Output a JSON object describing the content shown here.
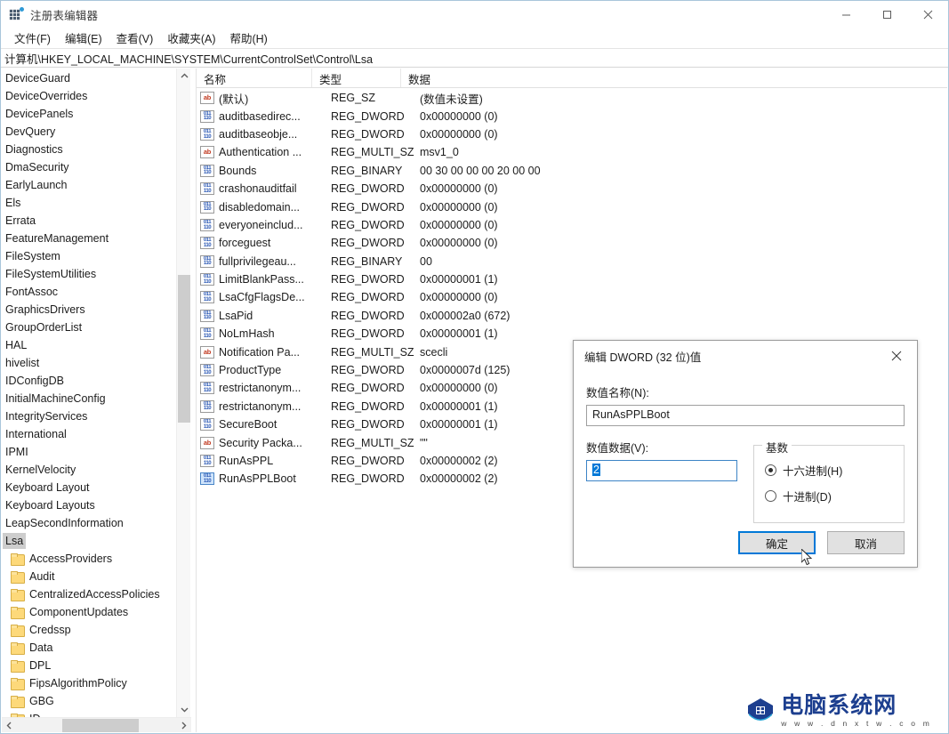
{
  "window": {
    "title": "注册表编辑器",
    "icon": "registry-icon",
    "controls": {
      "minimize": "minimize-icon",
      "maximize": "maximize-icon",
      "close": "close-icon"
    }
  },
  "menubar": {
    "items": [
      {
        "label": "文件(F)"
      },
      {
        "label": "编辑(E)"
      },
      {
        "label": "查看(V)"
      },
      {
        "label": "收藏夹(A)"
      },
      {
        "label": "帮助(H)"
      }
    ]
  },
  "addressbar": {
    "path": "计算机\\HKEY_LOCAL_MACHINE\\SYSTEM\\CurrentControlSet\\Control\\Lsa"
  },
  "tree": {
    "nodes": [
      {
        "label": "DeviceGuard",
        "folder": false,
        "selected": false
      },
      {
        "label": "DeviceOverrides",
        "folder": false,
        "selected": false
      },
      {
        "label": "DevicePanels",
        "folder": false,
        "selected": false
      },
      {
        "label": "DevQuery",
        "folder": false,
        "selected": false
      },
      {
        "label": "Diagnostics",
        "folder": false,
        "selected": false
      },
      {
        "label": "DmaSecurity",
        "folder": false,
        "selected": false
      },
      {
        "label": "EarlyLaunch",
        "folder": false,
        "selected": false
      },
      {
        "label": "Els",
        "folder": false,
        "selected": false
      },
      {
        "label": "Errata",
        "folder": false,
        "selected": false
      },
      {
        "label": "FeatureManagement",
        "folder": false,
        "selected": false
      },
      {
        "label": "FileSystem",
        "folder": false,
        "selected": false
      },
      {
        "label": "FileSystemUtilities",
        "folder": false,
        "selected": false
      },
      {
        "label": "FontAssoc",
        "folder": false,
        "selected": false
      },
      {
        "label": "GraphicsDrivers",
        "folder": false,
        "selected": false
      },
      {
        "label": "GroupOrderList",
        "folder": false,
        "selected": false
      },
      {
        "label": "HAL",
        "folder": false,
        "selected": false
      },
      {
        "label": "hivelist",
        "folder": false,
        "selected": false
      },
      {
        "label": "IDConfigDB",
        "folder": false,
        "selected": false
      },
      {
        "label": "InitialMachineConfig",
        "folder": false,
        "selected": false
      },
      {
        "label": "IntegrityServices",
        "folder": false,
        "selected": false
      },
      {
        "label": "International",
        "folder": false,
        "selected": false
      },
      {
        "label": "IPMI",
        "folder": false,
        "selected": false
      },
      {
        "label": "KernelVelocity",
        "folder": false,
        "selected": false
      },
      {
        "label": "Keyboard Layout",
        "folder": false,
        "selected": false
      },
      {
        "label": "Keyboard Layouts",
        "folder": false,
        "selected": false
      },
      {
        "label": "LeapSecondInformation",
        "folder": false,
        "selected": false
      },
      {
        "label": "Lsa",
        "folder": false,
        "selected": true
      },
      {
        "label": "AccessProviders",
        "folder": true,
        "selected": false
      },
      {
        "label": "Audit",
        "folder": true,
        "selected": false
      },
      {
        "label": "CentralizedAccessPolicies",
        "folder": true,
        "selected": false
      },
      {
        "label": "ComponentUpdates",
        "folder": true,
        "selected": false
      },
      {
        "label": "Credssp",
        "folder": true,
        "selected": false
      },
      {
        "label": "Data",
        "folder": true,
        "selected": false
      },
      {
        "label": "DPL",
        "folder": true,
        "selected": false
      },
      {
        "label": "FipsAlgorithmPolicy",
        "folder": true,
        "selected": false
      },
      {
        "label": "GBG",
        "folder": true,
        "selected": false
      },
      {
        "label": "ID",
        "folder": true,
        "selected": false
      }
    ]
  },
  "list": {
    "columns": [
      "名称",
      "类型",
      "数据"
    ],
    "rows": [
      {
        "icon": "string-value-icon",
        "kind": "ab",
        "name": "(默认)",
        "type": "REG_SZ",
        "data": "(数值未设置)",
        "selected": false
      },
      {
        "icon": "dword-value-icon",
        "kind": "bin",
        "name": "auditbasedirec...",
        "type": "REG_DWORD",
        "data": "0x00000000 (0)",
        "selected": false
      },
      {
        "icon": "dword-value-icon",
        "kind": "bin",
        "name": "auditbaseobje...",
        "type": "REG_DWORD",
        "data": "0x00000000 (0)",
        "selected": false
      },
      {
        "icon": "string-value-icon",
        "kind": "ab",
        "name": "Authentication ...",
        "type": "REG_MULTI_SZ",
        "data": "msv1_0",
        "selected": false
      },
      {
        "icon": "dword-value-icon",
        "kind": "bin",
        "name": "Bounds",
        "type": "REG_BINARY",
        "data": "00 30 00 00 00 20 00 00",
        "selected": false
      },
      {
        "icon": "dword-value-icon",
        "kind": "bin",
        "name": "crashonauditfail",
        "type": "REG_DWORD",
        "data": "0x00000000 (0)",
        "selected": false
      },
      {
        "icon": "dword-value-icon",
        "kind": "bin",
        "name": "disabledomain...",
        "type": "REG_DWORD",
        "data": "0x00000000 (0)",
        "selected": false
      },
      {
        "icon": "dword-value-icon",
        "kind": "bin",
        "name": "everyoneinclud...",
        "type": "REG_DWORD",
        "data": "0x00000000 (0)",
        "selected": false
      },
      {
        "icon": "dword-value-icon",
        "kind": "bin",
        "name": "forceguest",
        "type": "REG_DWORD",
        "data": "0x00000000 (0)",
        "selected": false
      },
      {
        "icon": "dword-value-icon",
        "kind": "bin",
        "name": "fullprivilegeau...",
        "type": "REG_BINARY",
        "data": "00",
        "selected": false
      },
      {
        "icon": "dword-value-icon",
        "kind": "bin",
        "name": "LimitBlankPass...",
        "type": "REG_DWORD",
        "data": "0x00000001 (1)",
        "selected": false
      },
      {
        "icon": "dword-value-icon",
        "kind": "bin",
        "name": "LsaCfgFlagsDe...",
        "type": "REG_DWORD",
        "data": "0x00000000 (0)",
        "selected": false
      },
      {
        "icon": "dword-value-icon",
        "kind": "bin",
        "name": "LsaPid",
        "type": "REG_DWORD",
        "data": "0x000002a0 (672)",
        "selected": false
      },
      {
        "icon": "dword-value-icon",
        "kind": "bin",
        "name": "NoLmHash",
        "type": "REG_DWORD",
        "data": "0x00000001 (1)",
        "selected": false
      },
      {
        "icon": "string-value-icon",
        "kind": "ab",
        "name": "Notification Pa...",
        "type": "REG_MULTI_SZ",
        "data": "scecli",
        "selected": false
      },
      {
        "icon": "dword-value-icon",
        "kind": "bin",
        "name": "ProductType",
        "type": "REG_DWORD",
        "data": "0x0000007d (125)",
        "selected": false
      },
      {
        "icon": "dword-value-icon",
        "kind": "bin",
        "name": "restrictanonym...",
        "type": "REG_DWORD",
        "data": "0x00000000 (0)",
        "selected": false
      },
      {
        "icon": "dword-value-icon",
        "kind": "bin",
        "name": "restrictanonym...",
        "type": "REG_DWORD",
        "data": "0x00000001 (1)",
        "selected": false
      },
      {
        "icon": "dword-value-icon",
        "kind": "bin",
        "name": "SecureBoot",
        "type": "REG_DWORD",
        "data": "0x00000001 (1)",
        "selected": false
      },
      {
        "icon": "string-value-icon",
        "kind": "ab",
        "name": "Security Packa...",
        "type": "REG_MULTI_SZ",
        "data": "\"\"",
        "selected": false
      },
      {
        "icon": "dword-value-icon",
        "kind": "bin",
        "name": "RunAsPPL",
        "type": "REG_DWORD",
        "data": "0x00000002 (2)",
        "selected": false
      },
      {
        "icon": "dword-value-icon",
        "kind": "bin",
        "name": "RunAsPPLBoot",
        "type": "REG_DWORD",
        "data": "0x00000002 (2)",
        "selected": true
      }
    ]
  },
  "dialog": {
    "title": "编辑 DWORD (32 位)值",
    "name_label": "数值名称(N):",
    "name_value": "RunAsPPLBoot",
    "data_label": "数值数据(V):",
    "data_value": "2",
    "base_legend": "基数",
    "base_options": [
      {
        "label": "十六进制(H)",
        "checked": true
      },
      {
        "label": "十进制(D)",
        "checked": false
      }
    ],
    "ok_label": "确定",
    "cancel_label": "取消",
    "close_icon": "close-icon"
  },
  "watermark": {
    "title": "电脑系统网",
    "url": "w w w . d n x t w . c o m"
  },
  "colors": {
    "accent": "#0078d7",
    "selection": "#cdcdcd",
    "folder": "#fdd97a",
    "string_icon": "#c23b22",
    "dword_icon": "#2a58b5",
    "watermark": "#1d3f8f"
  }
}
